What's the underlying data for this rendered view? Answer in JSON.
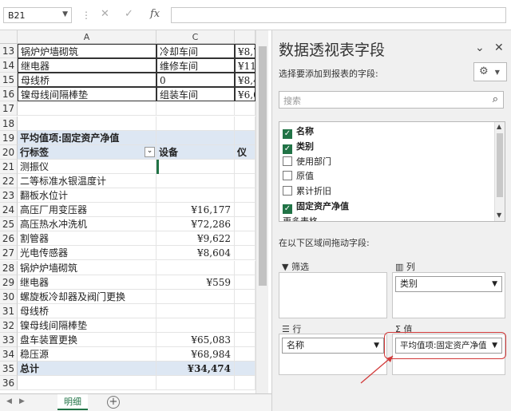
{
  "formula_bar": {
    "name_box": "B21",
    "cancel_glyph": "✕",
    "confirm_glyph": "✓",
    "fx_glyph": "fx",
    "formula": ""
  },
  "columns": {
    "a": "A",
    "c": "C"
  },
  "rows": [
    {
      "num": "13",
      "a": "锅炉炉墙砌筑",
      "c": "冷却车间",
      "d": "¥8,7",
      "style": "boxed"
    },
    {
      "num": "14",
      "a": "继电器",
      "c": "维修车间",
      "d": "¥11,",
      "style": "boxed"
    },
    {
      "num": "15",
      "a": "母线桥",
      "c": "0",
      "d": "¥8,4",
      "style": "boxed"
    },
    {
      "num": "16",
      "a": "镍母线间隔棒垫",
      "c": "组装车间",
      "d": "¥6,0",
      "style": "boxed"
    },
    {
      "num": "17",
      "a": "",
      "c": "",
      "d": "",
      "style": ""
    },
    {
      "num": "18",
      "a": "",
      "c": "",
      "d": "",
      "style": ""
    },
    {
      "num": "19",
      "a": "平均值项:固定资产净值",
      "c": "",
      "d": "",
      "style": "pt-head"
    },
    {
      "num": "20",
      "a": "行标签",
      "c": "设备",
      "d": "仪",
      "style": "pt-head",
      "filter": true
    },
    {
      "num": "21",
      "a": "测振仪",
      "c": "",
      "d": "",
      "style": "sel"
    },
    {
      "num": "22",
      "a": "二等标准水银温度计",
      "c": "",
      "d": "",
      "style": ""
    },
    {
      "num": "23",
      "a": "翻板水位计",
      "c": "",
      "d": "",
      "style": ""
    },
    {
      "num": "24",
      "a": "高压厂用变压器",
      "c": "¥16,177",
      "d": "",
      "style": ""
    },
    {
      "num": "25",
      "a": "高压热水冲洗机",
      "c": "¥72,286",
      "d": "",
      "style": ""
    },
    {
      "num": "26",
      "a": "割管器",
      "c": "¥9,622",
      "d": "",
      "style": ""
    },
    {
      "num": "27",
      "a": "光电传感器",
      "c": "¥8,604",
      "d": "",
      "style": ""
    },
    {
      "num": "28",
      "a": "锅炉炉墙砌筑",
      "c": "",
      "d": "",
      "style": ""
    },
    {
      "num": "29",
      "a": "继电器",
      "c": "¥559",
      "d": "",
      "style": ""
    },
    {
      "num": "30",
      "a": "螺旋板冷却器及阀门更换",
      "c": "",
      "d": "",
      "style": ""
    },
    {
      "num": "31",
      "a": "母线桥",
      "c": "",
      "d": "",
      "style": ""
    },
    {
      "num": "32",
      "a": "镍母线间隔棒垫",
      "c": "",
      "d": "",
      "style": ""
    },
    {
      "num": "33",
      "a": "盘车装置更换",
      "c": "¥65,083",
      "d": "",
      "style": ""
    },
    {
      "num": "34",
      "a": "稳压源",
      "c": "¥68,984",
      "d": "",
      "style": ""
    },
    {
      "num": "35",
      "a": "总计",
      "c": "¥34,474",
      "d": "",
      "style": "pt-total"
    },
    {
      "num": "36",
      "a": "",
      "c": "",
      "d": "",
      "style": ""
    }
  ],
  "sheet_tab": "明细",
  "add_sheet_glyph": "+",
  "panel": {
    "title": "数据透视表字段",
    "dropdown_glyph": "⌄",
    "close_glyph": "✕",
    "subtitle": "选择要添加到报表的字段:",
    "search_placeholder": "搜索",
    "fields": [
      {
        "label": "名称",
        "checked": true
      },
      {
        "label": "类别",
        "checked": true
      },
      {
        "label": "使用部门",
        "checked": false
      },
      {
        "label": "原值",
        "checked": false
      },
      {
        "label": "累计折旧",
        "checked": false
      },
      {
        "label": "固定资产净值",
        "checked": true
      },
      {
        "label": "更多表格",
        "checked": false
      }
    ],
    "drag_label": "在以下区域间拖动字段:",
    "areas": {
      "filter": "筛选",
      "columns": "列",
      "rows": "行",
      "values": "值"
    },
    "columns_field": "类别",
    "rows_field": "名称",
    "values_field": "平均值项:固定资产净值"
  },
  "colors": {
    "excel_green": "#217346",
    "highlight_red": "#d23a3a",
    "pivot_header": "#dde7f3"
  }
}
